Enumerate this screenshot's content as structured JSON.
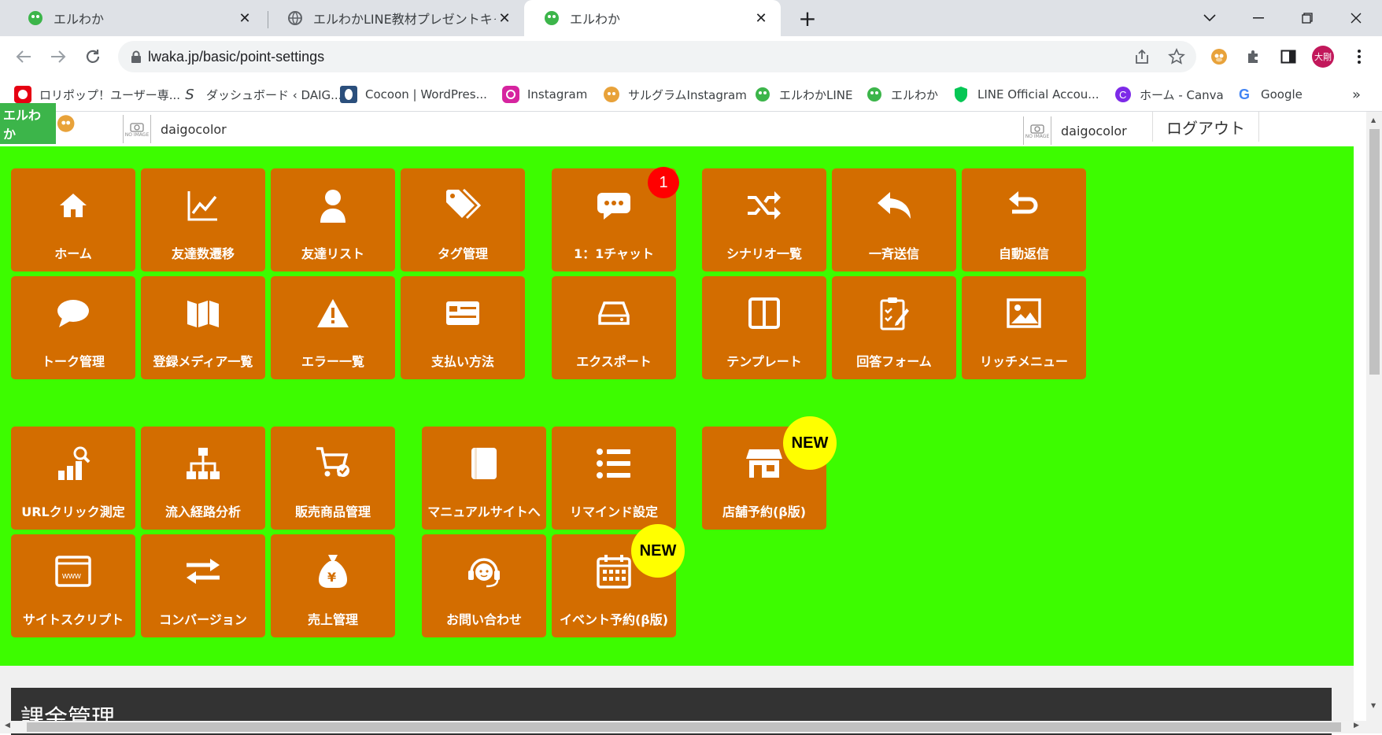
{
  "browser": {
    "tabs": [
      {
        "title": "エルわか"
      },
      {
        "title": "エルわかLINE教材プレゼントキャンペ-"
      },
      {
        "title": "エルわか"
      }
    ],
    "url": "lwaka.jp/basic/point-settings",
    "profile_label": "大剛"
  },
  "bookmarks": [
    {
      "label": "ロリポップ！ユーザー専..."
    },
    {
      "label": "ダッシュボード ‹ DAIG..."
    },
    {
      "label": "Cocoon | WordPres..."
    },
    {
      "label": "Instagram"
    },
    {
      "label": "サルグラムInstagram"
    },
    {
      "label": "エルわかLINE"
    },
    {
      "label": "エルわか"
    },
    {
      "label": "LINE Official Accou..."
    },
    {
      "label": "ホーム - Canva"
    },
    {
      "label": "Google"
    }
  ],
  "header": {
    "logo_text": "エルわか",
    "username_left": "daigocolor",
    "username_right": "daigocolor",
    "noimage_text": "NO IMAGE",
    "logout_label": "ログアウト"
  },
  "menu": {
    "row1": [
      {
        "label": "ホーム",
        "icon": "home-icon"
      },
      {
        "label": "友達数遷移",
        "icon": "chart-icon"
      },
      {
        "label": "友達リスト",
        "icon": "user-icon"
      },
      {
        "label": "タグ管理",
        "icon": "tags-icon"
      },
      {
        "label": "1：1チャット",
        "icon": "chat-icon"
      },
      {
        "label": "シナリオ一覧",
        "icon": "shuffle-icon"
      },
      {
        "label": "一斉送信",
        "icon": "reply-icon"
      },
      {
        "label": "自動返信",
        "icon": "undo-icon"
      }
    ],
    "row2": [
      {
        "label": "トーク管理",
        "icon": "comment-icon"
      },
      {
        "label": "登録メディア一覧",
        "icon": "map-icon"
      },
      {
        "label": "エラー一覧",
        "icon": "warning-icon"
      },
      {
        "label": "支払い方法",
        "icon": "card-icon"
      },
      {
        "label": "エクスポート",
        "icon": "drive-icon"
      },
      {
        "label": "テンプレート",
        "icon": "columns-icon"
      },
      {
        "label": "回答フォーム",
        "icon": "clipboard-icon"
      },
      {
        "label": "リッチメニュー",
        "icon": "image-icon"
      }
    ],
    "row3": [
      {
        "label": "URLクリック測定",
        "icon": "analytics-icon"
      },
      {
        "label": "流入経路分析",
        "icon": "sitemap-icon"
      },
      {
        "label": "販売商品管理",
        "icon": "cart-icon"
      },
      {
        "label": "マニュアルサイトへ",
        "icon": "book-icon"
      },
      {
        "label": "リマインド設定",
        "icon": "list-icon"
      },
      {
        "label": "店舗予約(β版)",
        "icon": "store-icon"
      }
    ],
    "row4": [
      {
        "label": "サイトスクリプト",
        "icon": "www-icon"
      },
      {
        "label": "コンバージョン",
        "icon": "exchange-icon"
      },
      {
        "label": "売上管理",
        "icon": "yen-bag-icon"
      },
      {
        "label": "お問い合わせ",
        "icon": "headset-icon"
      },
      {
        "label": "イベント予約(β版)",
        "icon": "calendar-icon"
      }
    ],
    "chat_badge": "1",
    "new_badge": "NEW"
  },
  "section": {
    "title": "課金管理"
  },
  "colors": {
    "menu_bg": "#3dfc00",
    "tile_bg": "#d36d00",
    "badge_red": "#ff0000",
    "badge_new": "#ffff00"
  }
}
